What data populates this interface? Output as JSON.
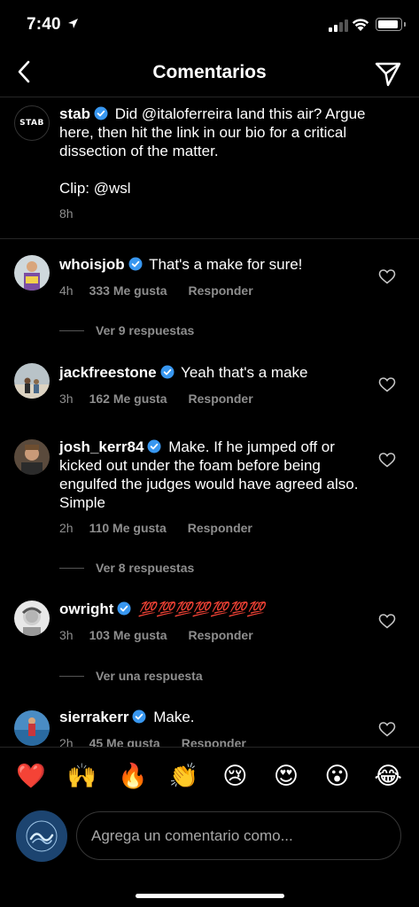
{
  "status_bar": {
    "time": "7:40"
  },
  "header": {
    "title": "Comentarios"
  },
  "caption": {
    "username": "stab",
    "text": "Did @italoferreira land this air? Argue here, then hit the link in our bio for a critical dissection of the matter.",
    "clip": "Clip: @wsl",
    "time": "8h",
    "avatar_label": "STAB"
  },
  "comments": [
    {
      "username": "whoisjob",
      "text": "That's a make for sure!",
      "time": "4h",
      "likes": "333 Me gusta",
      "reply": "Responder",
      "view_replies": "Ver 9 respuestas"
    },
    {
      "username": "jackfreestone",
      "text": "Yeah that's a make",
      "time": "3h",
      "likes": "162 Me gusta",
      "reply": "Responder"
    },
    {
      "username": "josh_kerr84",
      "text": "Make. If he jumped off or kicked out under the foam before being engulfed the judges would have agreed also. Simple",
      "time": "2h",
      "likes": "110 Me gusta",
      "reply": "Responder",
      "view_replies": "Ver 8 respuestas"
    },
    {
      "username": "owright",
      "text": "💯💯💯💯💯💯💯",
      "time": "3h",
      "likes": "103 Me gusta",
      "reply": "Responder",
      "view_replies": "Ver una respuesta"
    },
    {
      "username": "sierrakerr",
      "text": "Make.",
      "time": "2h",
      "likes": "45 Me gusta",
      "reply": "Responder"
    }
  ],
  "emoji_bar": [
    "❤️",
    "🙌",
    "🔥",
    "👏",
    "😢",
    "😍",
    "😮",
    "😂"
  ],
  "input": {
    "placeholder": "Agrega un comentario como..."
  },
  "colors": {
    "background": "#000000",
    "secondary_text": "#8e8e8e",
    "verified": "#3897f0",
    "divider": "#262626"
  }
}
